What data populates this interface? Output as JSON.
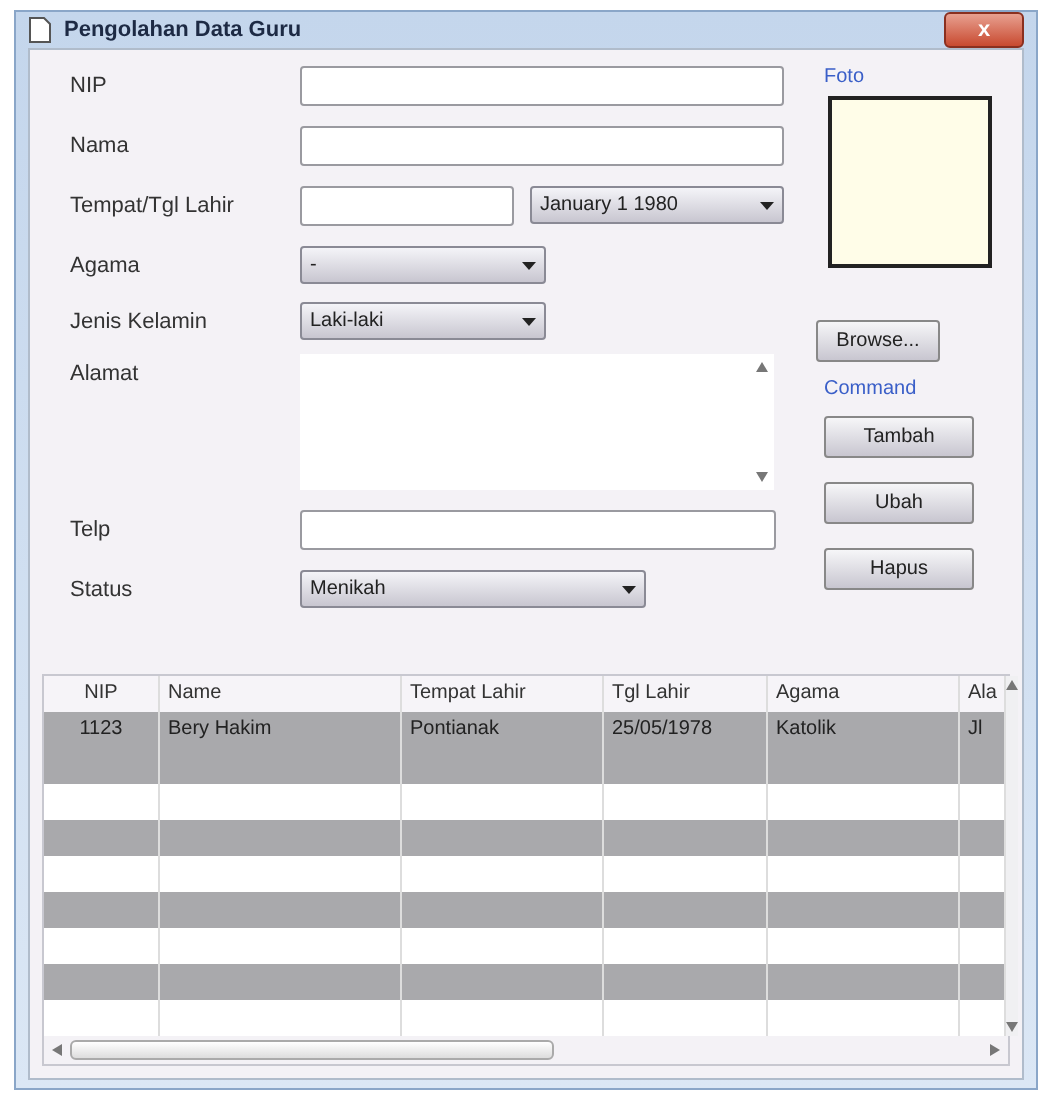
{
  "window": {
    "title": "Pengolahan Data Guru",
    "close": "x"
  },
  "fields": [
    {
      "label": "NIP",
      "kind": "text"
    },
    {
      "label": "Nama",
      "kind": "text"
    },
    {
      "label": "Tempat/Tgl Lahir",
      "kind": "text-date",
      "date": "January 1 1980"
    },
    {
      "label": "Agama",
      "kind": "combo",
      "value": "-"
    },
    {
      "label": "Jenis Kelamin",
      "kind": "combo",
      "value": "Laki-laki"
    },
    {
      "label": "Alamat",
      "kind": "textarea"
    },
    {
      "label": "Telp",
      "kind": "text"
    },
    {
      "label": "Status",
      "kind": "combo",
      "value": "Menikah"
    }
  ],
  "photo": {
    "label": "Foto",
    "browse": "Browse..."
  },
  "command": {
    "label": "Command",
    "buttons": [
      "Tambah",
      "Ubah",
      "Hapus"
    ]
  },
  "table": {
    "columns": [
      "NIP",
      "Name",
      "Tempat Lahir",
      "Tgl Lahir",
      "Agama",
      "Ala"
    ],
    "rows": [
      {
        "selected": true,
        "cells": [
          "1123",
          "Bery Hakim",
          "Pontianak",
          "25/05/1978",
          "Katolik",
          "Jl"
        ]
      }
    ]
  }
}
